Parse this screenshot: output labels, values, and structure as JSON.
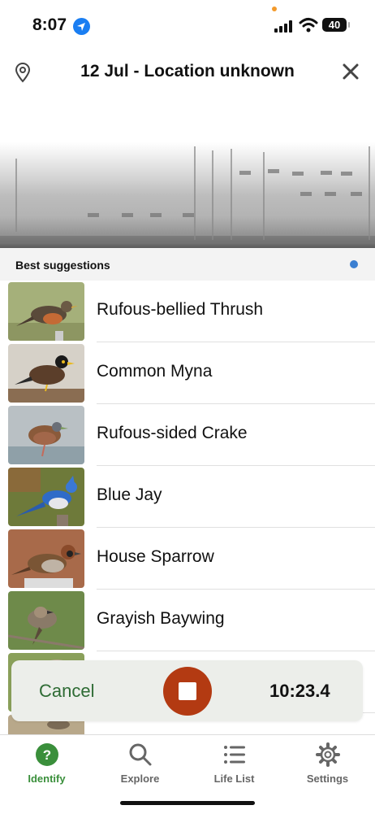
{
  "status": {
    "time": "8:07",
    "battery": "40"
  },
  "header": {
    "title": "12 Jul - Location unknown"
  },
  "suggestions": {
    "label": "Best suggestions",
    "items": [
      {
        "name": "Rufous-bellied Thrush"
      },
      {
        "name": "Common Myna"
      },
      {
        "name": "Rufous-sided Crake"
      },
      {
        "name": "Blue Jay"
      },
      {
        "name": "House Sparrow"
      },
      {
        "name": "Grayish Baywing"
      }
    ]
  },
  "recorder": {
    "cancel_label": "Cancel",
    "timer": "10:23.4"
  },
  "tabs": [
    {
      "label": "Identify",
      "icon": "question-icon"
    },
    {
      "label": "Explore",
      "icon": "search-icon"
    },
    {
      "label": "Life List",
      "icon": "list-icon"
    },
    {
      "label": "Settings",
      "icon": "gear-icon"
    }
  ],
  "colors": {
    "accent_green": "#3a8f3b",
    "cancel_green": "#2e6b34",
    "stop_red": "#b33a12",
    "dot_blue": "#3b7fd1"
  }
}
